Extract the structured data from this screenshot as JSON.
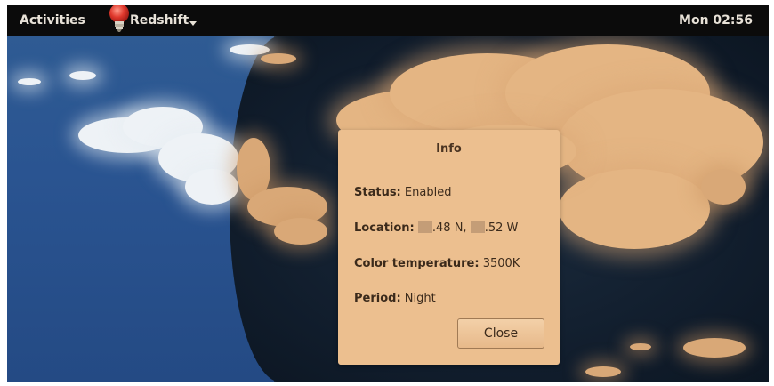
{
  "topbar": {
    "activities_label": "Activities",
    "app_name": "Redshift",
    "app_icon": "lightbulb-icon",
    "clock": "Mon 02:56"
  },
  "dialog": {
    "title": "Info",
    "status_label": "Status:",
    "status_value": "Enabled",
    "location_label": "Location:",
    "location_lat": ".48 N,",
    "location_lon": ".52 W",
    "temperature_label": "Color temperature:",
    "temperature_value": "3500K",
    "period_label": "Period:",
    "period_value": "Night",
    "close_label": "Close"
  },
  "colors": {
    "topbar_bg": "#0b0b0b",
    "dialog_bg": "#ecbf8f",
    "sky_blue": "#2a5491",
    "sky_dark": "#101c2b"
  }
}
